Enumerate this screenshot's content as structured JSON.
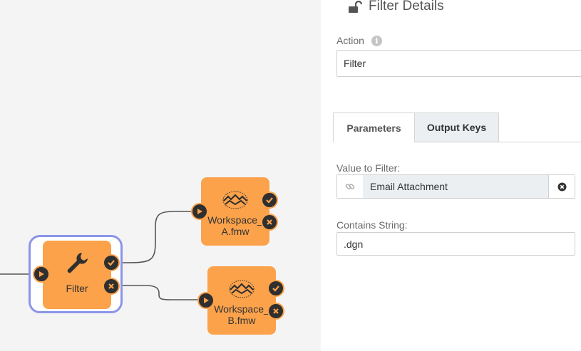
{
  "canvas": {
    "nodes": [
      {
        "label": "Filter",
        "icon": "wrench-icon"
      },
      {
        "label_line1": "Workspace_",
        "label_line2": "A.fmw",
        "icon": "fme-workspace-icon"
      },
      {
        "label_line1": "Workspace_",
        "label_line2": "B.fmw",
        "icon": "fme-workspace-icon"
      }
    ],
    "colors": {
      "node": "#fba24b",
      "selection": "#8b95e8",
      "wire": "#555555",
      "background": "#f4f4f4"
    }
  },
  "panel": {
    "title": "Filter Details",
    "action_label": "Action",
    "action_value": "Filter",
    "tabs": [
      {
        "label": "Parameters",
        "active": true
      },
      {
        "label": "Output Keys",
        "active": false
      }
    ],
    "value_to_filter_label": "Value to Filter:",
    "value_to_filter_value": "Email Attachment",
    "contains_string_label": "Contains String:",
    "contains_string_value": ".dgn"
  }
}
